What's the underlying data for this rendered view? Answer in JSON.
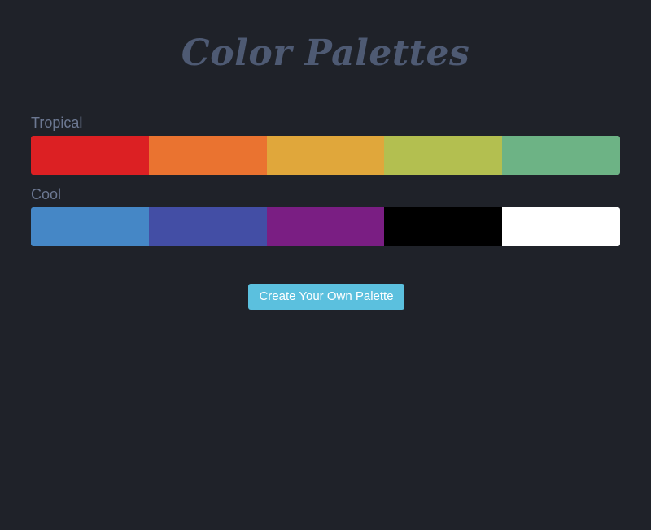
{
  "page": {
    "title": "Color Palettes",
    "background": "#1f2229"
  },
  "palettes": [
    {
      "name": "Tropical",
      "colors": [
        "#dc2023",
        "#ea7330",
        "#e0a73b",
        "#b3bf50",
        "#6db385"
      ]
    },
    {
      "name": "Cool",
      "colors": [
        "#4587c6",
        "#434ea5",
        "#7a1e83",
        "#000000",
        "#ffffff"
      ]
    }
  ],
  "actions": {
    "create_label": "Create Your Own Palette",
    "create_color": "#5bc0de"
  }
}
